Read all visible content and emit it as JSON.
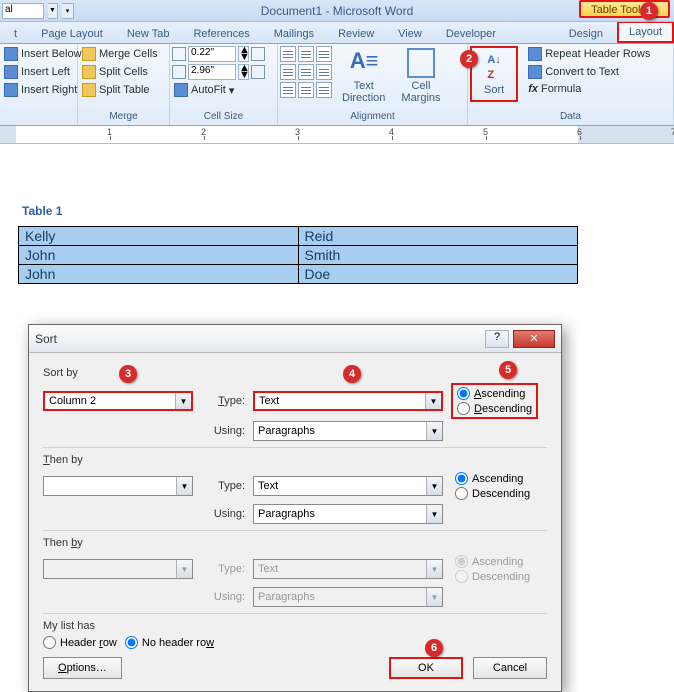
{
  "title": "Document1 - Microsoft Word",
  "table_tools": "Table Tools",
  "qat_style": "al",
  "tabs": {
    "t": "t",
    "page_layout": "Page Layout",
    "new_tab": "New Tab",
    "references": "References",
    "mailings": "Mailings",
    "review": "Review",
    "view": "View",
    "developer": "Developer",
    "design": "Design",
    "layout": "Layout"
  },
  "ribbon": {
    "rows": {
      "below": "Insert Below",
      "left": "Insert Left",
      "right": "Insert Right"
    },
    "merge": {
      "merge": "Merge Cells",
      "split": "Split Cells",
      "table": "Split Table",
      "label": "Merge"
    },
    "size": {
      "h": "0.22\"",
      "w": "2.96\"",
      "autofit": "AutoFit",
      "label": "Cell Size"
    },
    "align": {
      "dir": "Text\nDirection",
      "margins": "Cell\nMargins",
      "label": "Alignment"
    },
    "sort": "Sort",
    "data": {
      "repeat": "Repeat Header Rows",
      "convert": "Convert to Text",
      "formula": "Formula",
      "label": "Data"
    }
  },
  "caption": "Table 1",
  "table": [
    [
      "Kelly",
      "Reid"
    ],
    [
      "John",
      "Smith"
    ],
    [
      "John",
      "Doe"
    ]
  ],
  "dlg": {
    "title": "Sort",
    "sortby": "Sort by",
    "thenby": "Then by",
    "thenby2": "Then by",
    "col": "Column 2",
    "type_lbl": "Type:",
    "using_lbl": "Using:",
    "type": "Text",
    "using": "Paragraphs",
    "asc": "Ascending",
    "desc": "Descending",
    "mylist": "My list has",
    "header": "Header row",
    "noheader": "No header row",
    "options": "Options…",
    "ok": "OK",
    "cancel": "Cancel"
  },
  "badges": {
    "1": "1",
    "2": "2",
    "3": "3",
    "4": "4",
    "5": "5",
    "6": "6"
  }
}
